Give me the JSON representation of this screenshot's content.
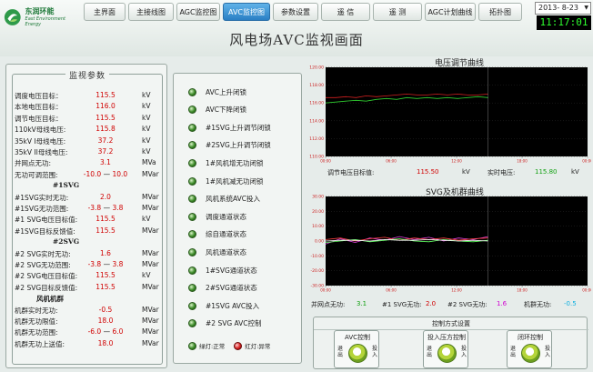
{
  "app": {
    "brand_name": "东润环能",
    "brand_sub": "East Environment Energy",
    "page_title": "风电场AVC监视画面",
    "date_value": "2013-  8-23",
    "clock": "11:17:01"
  },
  "nav": {
    "tabs": [
      {
        "label": "主界面",
        "active": false
      },
      {
        "label": "主接线图",
        "active": false
      },
      {
        "label": "AGC监控图",
        "active": false
      },
      {
        "label": "AVC监控图",
        "active": true
      },
      {
        "label": "参数设置",
        "active": false
      },
      {
        "label": "遥  信",
        "active": false
      },
      {
        "label": "遥  测",
        "active": false
      },
      {
        "label": "AGC计划曲线",
        "active": false
      },
      {
        "label": "拓扑图",
        "active": false
      }
    ]
  },
  "params": {
    "title": "监视参数",
    "rows": [
      {
        "label": "调度电压目标：",
        "value": "115.5",
        "unit": "kV"
      },
      {
        "label": "本地电压目标：",
        "value": "116.0",
        "unit": "kV"
      },
      {
        "label": "调节电压目标：",
        "value": "115.5",
        "unit": "kV"
      },
      {
        "label": "110kV母线电压:",
        "value": "115.8",
        "unit": "kV"
      },
      {
        "label": "35kV I母线电压:",
        "value": "37.2",
        "unit": "kV"
      },
      {
        "label": "35kV II母线电压:",
        "value": "37.2",
        "unit": "kV"
      },
      {
        "label": "并网点无功:",
        "value": "3.1",
        "unit": "MVa"
      },
      {
        "label": "无功可调范围:",
        "min": "-10.0",
        "max": "10.0",
        "unit": "MVar"
      },
      {
        "section": "#1SVG"
      },
      {
        "label": "#1SVG实时无功:",
        "value": "2.0",
        "unit": "MVar"
      },
      {
        "label": "#1SVG无功范围:",
        "min": "-3.8",
        "max": "3.8",
        "unit": "MVar"
      },
      {
        "label": "#1 SVG电压目标值:",
        "value": "115.5",
        "unit": "kV"
      },
      {
        "label": "#1SVG目标反馈值:",
        "value": "115.5",
        "unit": "MVar"
      },
      {
        "section": "#2SVG"
      },
      {
        "label": "#2 SVG实时无功:",
        "value": "1.6",
        "unit": "MVar"
      },
      {
        "label": "#2 SVG无功范围:",
        "min": "-3.8",
        "max": "3.8",
        "unit": "MVar"
      },
      {
        "label": "#2 SVG电压目标值:",
        "value": "115.5",
        "unit": "kV"
      },
      {
        "label": "#2 SVG目标反馈值:",
        "value": "115.5",
        "unit": "MVar"
      },
      {
        "section": "风机机群"
      },
      {
        "label": "机群实时无功:",
        "value": "-0.5",
        "unit": "MVar"
      },
      {
        "label": "机群无功限值:",
        "value": "18.0",
        "unit": "MVar"
      },
      {
        "label": "机群无功范围:",
        "min": "-6.0",
        "max": "6.0",
        "unit": "MVar"
      },
      {
        "label": "机群无功上送值:",
        "value": "18.0",
        "unit": "MVar"
      }
    ]
  },
  "signals": {
    "items": [
      {
        "label": "AVC上升闭锁",
        "state": "green"
      },
      {
        "label": "AVC下降闭锁",
        "state": "green"
      },
      {
        "label": "#1SVG上升调节闭锁",
        "state": "green"
      },
      {
        "label": "#2SVG上升调节闭锁",
        "state": "green"
      },
      {
        "label": "1#风机增无功闭锁",
        "state": "green"
      },
      {
        "label": "1#风机减无功闭锁",
        "state": "green"
      },
      {
        "label": "风机系统AVC投入",
        "state": "green"
      },
      {
        "label": "调度通道状态",
        "state": "green"
      },
      {
        "label": "综自通道状态",
        "state": "green"
      },
      {
        "label": "风机通道状态",
        "state": "green"
      },
      {
        "label": "1#SVG通道状态",
        "state": "green"
      },
      {
        "label": "2#SVG通道状态",
        "state": "green"
      },
      {
        "label": "#1SVG AVC投入",
        "state": "green"
      },
      {
        "label": "#2 SVG AVC控制",
        "state": "green"
      }
    ],
    "legend_normal": "绿灯:正常",
    "legend_abnormal": "红灯:异常"
  },
  "voltage_panel": {
    "readout_target_label": "调节电压目标值:",
    "readout_target_value": "115.50",
    "readout_target_unit": "kV",
    "readout_actual_label": "实时电压:",
    "readout_actual_value": "115.80",
    "readout_actual_unit": "kV"
  },
  "svg_panel": {
    "readout_grid_label": "并网点无功:",
    "readout_grid_value": "3.1",
    "readout_svg1_label": "#1 SVG无功:",
    "readout_svg1_value": "2.0",
    "readout_svg2_label": "#2 SVG无功:",
    "readout_svg2_value": "1.6",
    "readout_fan_label": "机群无功:",
    "readout_fan_value": "-0.5"
  },
  "control": {
    "title": "控制方式设置",
    "boxes": [
      {
        "title": "AVC控制",
        "left": "退出",
        "right": "投入"
      },
      {
        "title": "投入压方控制",
        "left": "退出",
        "right": "投入"
      },
      {
        "title": "闭环控制",
        "left": "退出",
        "right": "投入"
      }
    ]
  },
  "colors": {
    "plot_bg": "#000000",
    "target_line": "#d22020",
    "actual_line": "#30d030",
    "svg1_line": "#e040e0",
    "svg2_line": "#ff4040",
    "fan_line": "#60ff60",
    "grid_line": "#ffffff",
    "accent": "#2a7fc4"
  },
  "chart_data": [
    {
      "type": "line",
      "title": "电压调节曲线",
      "y_ticks": [
        "120.00",
        "118.00",
        "116.00",
        "114.00",
        "112.00",
        "110.00"
      ],
      "ylim": [
        110,
        120
      ],
      "x_ticks": [
        "00:00",
        "06:00",
        "12:00",
        "18:00",
        "00:00"
      ],
      "series": [
        {
          "values": [
            116.6,
            116.6,
            116.7,
            116.6,
            116.8,
            116.7,
            116.8,
            116.9,
            117.0,
            116.9,
            116.9,
            117.0,
            116.9,
            117.0,
            116.9,
            116.9,
            117.0
          ]
        },
        {
          "values": [
            116.0,
            116.1,
            116.2,
            116.3,
            116.2,
            116.4,
            116.5,
            116.4,
            116.6,
            116.5,
            116.6,
            116.5,
            116.6,
            116.5,
            116.6,
            116.7,
            116.6
          ]
        }
      ]
    },
    {
      "type": "line",
      "title": "SVG及机群曲线",
      "y_ticks": [
        "30.00",
        "20.00",
        "10.00",
        "0.00",
        "-10.00",
        "-20.00",
        "-30.00"
      ],
      "ylim": [
        -30,
        30
      ],
      "x_ticks": [
        "00:00",
        "06:00",
        "12:00",
        "18:00",
        "00:00"
      ],
      "series": [
        {
          "values": [
            -2.0,
            1.5,
            -1.0,
            2.0,
            0.5,
            3.0,
            1.0,
            2.5,
            0.0,
            2.0,
            1.0,
            3.0
          ]
        },
        {
          "values": [
            1.0,
            2.0,
            0.0,
            1.5,
            2.5,
            0.5,
            2.0,
            1.0,
            2.0,
            0.5,
            1.5,
            2.0
          ]
        },
        {
          "values": [
            -1.0,
            0.0,
            1.0,
            -0.5,
            0.5,
            1.5,
            0.0,
            -0.5,
            1.0,
            0.0,
            -0.5,
            0.5
          ]
        },
        {
          "values": [
            0.0,
            0.5,
            0.5,
            0.0,
            1.0,
            0.5,
            0.5,
            1.0,
            0.5,
            0.0,
            0.5,
            0.0
          ]
        }
      ]
    }
  ]
}
